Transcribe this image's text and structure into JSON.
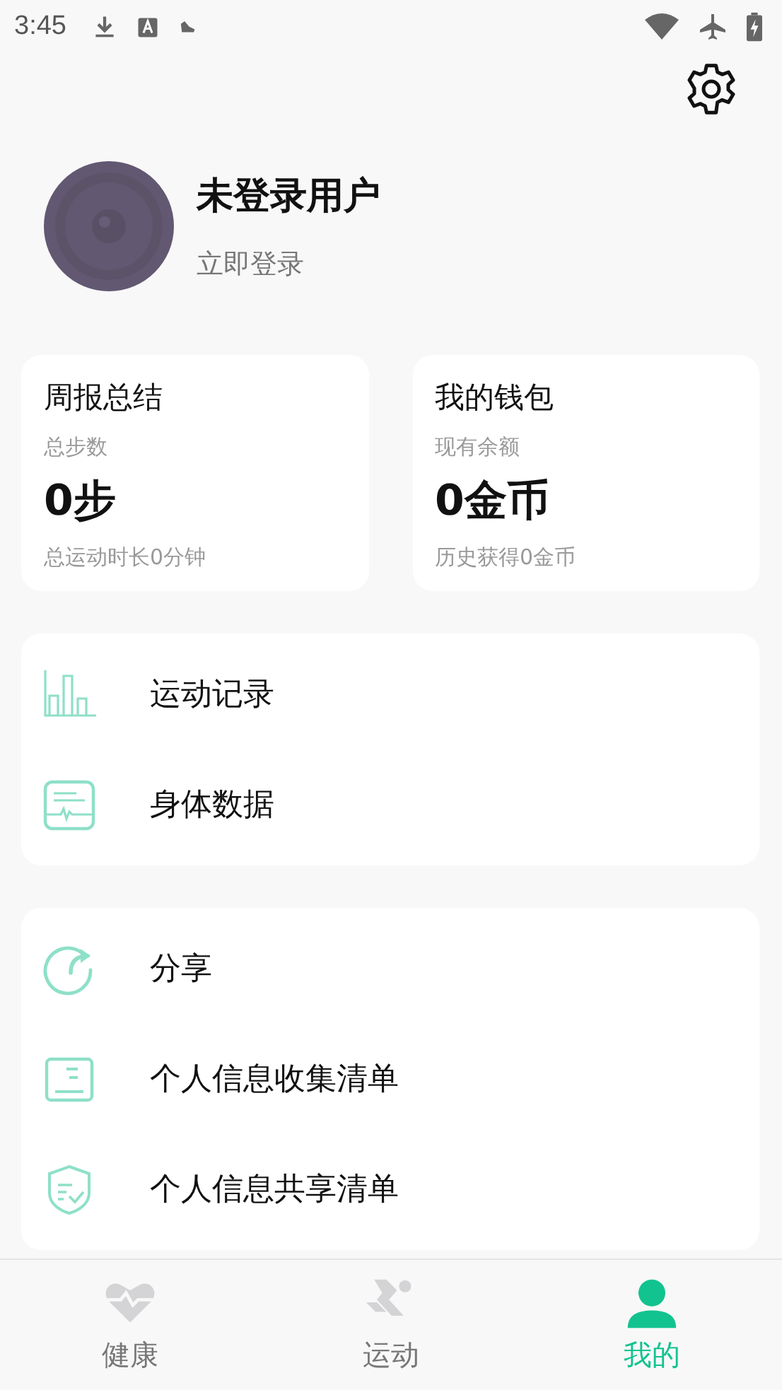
{
  "status_bar": {
    "time": "3:45"
  },
  "profile": {
    "name": "未登录用户",
    "action": "立即登录"
  },
  "summary_cards": [
    {
      "title": "周报总结",
      "label": "总步数",
      "value": "0步",
      "footer": "总运动时长0分钟"
    },
    {
      "title": "我的钱包",
      "label": "现有余额",
      "value": "0金币",
      "footer": "历史获得0金币"
    }
  ],
  "menu_groups": [
    {
      "items": [
        {
          "kind": "chart",
          "label": "运动记录"
        },
        {
          "kind": "body",
          "label": "身体数据"
        }
      ]
    },
    {
      "items": [
        {
          "kind": "share",
          "label": "分享"
        },
        {
          "kind": "list",
          "label": "个人信息收集清单"
        },
        {
          "kind": "shield",
          "label": "个人信息共享清单"
        }
      ]
    }
  ],
  "tabs": [
    {
      "kind": "health",
      "label": "健康",
      "selected": false
    },
    {
      "kind": "sport",
      "label": "运动",
      "selected": false
    },
    {
      "kind": "me",
      "label": "我的",
      "selected": true
    }
  ]
}
